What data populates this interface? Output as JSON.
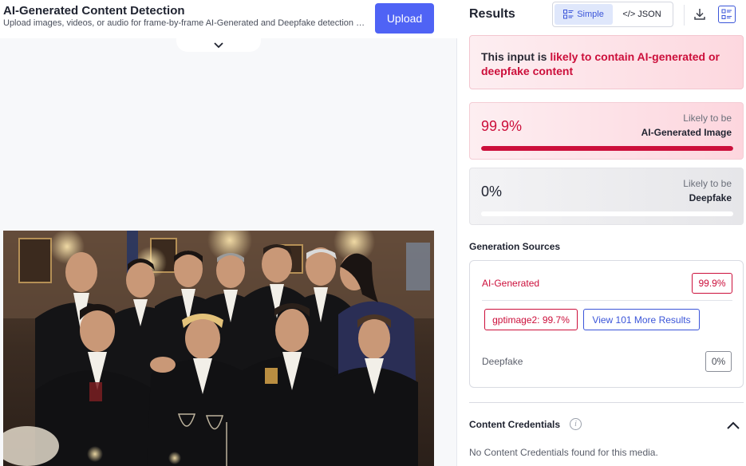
{
  "header": {
    "title": "AI-Generated Content Detection",
    "subtitle": "Upload images, videos, or audio for frame-by-frame AI-Generated and Deepfake detection with...",
    "upload_label": "Upload"
  },
  "results": {
    "title": "Results",
    "view_options": [
      {
        "label": "Simple",
        "active": true,
        "icon": "simple-view-icon"
      },
      {
        "label": "</> JSON",
        "active": false
      }
    ],
    "verdict": {
      "prefix": "This input is ",
      "highlight": "likely to contain AI-generated or deepfake content"
    },
    "ai_score": {
      "value": "99.9%",
      "fraction": 0.999,
      "label_pre": "Likely to be",
      "label_main": "AI-Generated Image"
    },
    "deepfake_score": {
      "value": "0%",
      "fraction": 0.0,
      "label_pre": "Likely to be",
      "label_main": "Deepfake"
    }
  },
  "generation_sources": {
    "title": "Generation Sources",
    "ai_generated": {
      "label": "AI-Generated",
      "value": "99.9%"
    },
    "model_tag": "gptimage2: 99.7%",
    "more_results_label": "View 101 More Results",
    "deepfake": {
      "label": "Deepfake",
      "value": "0%"
    }
  },
  "content_credentials": {
    "title": "Content Credentials",
    "message": "No Content Credentials found for this media."
  },
  "colors": {
    "accent_blue": "#4f63f5",
    "alert_red": "#cc0f3b"
  }
}
